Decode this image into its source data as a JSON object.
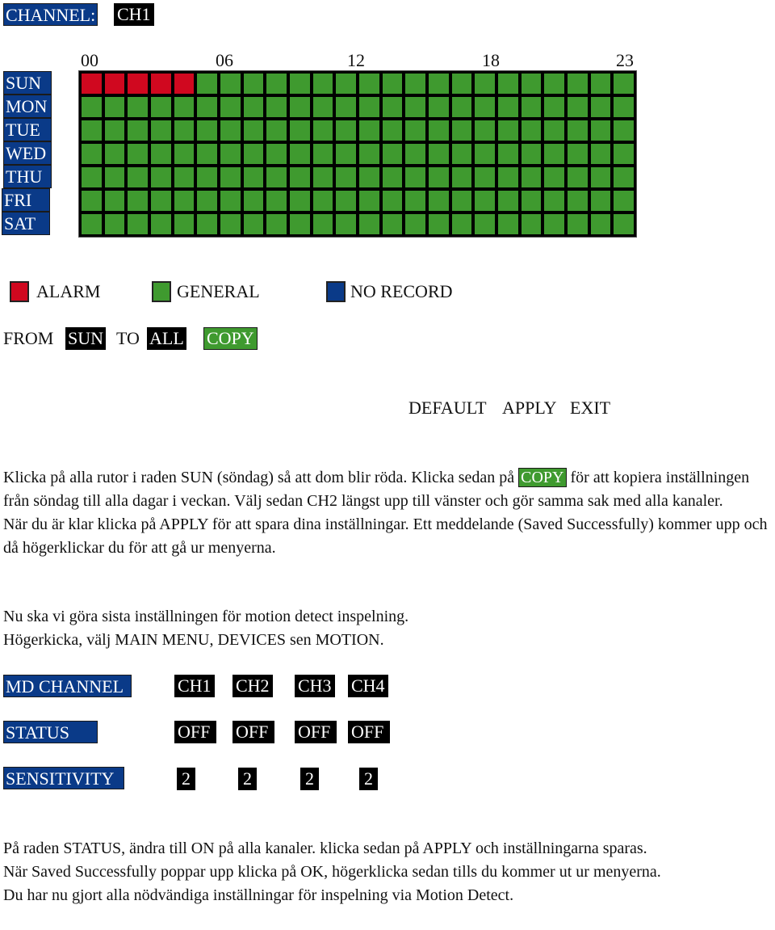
{
  "channel": {
    "label": "CHANNEL:",
    "value": "CH1"
  },
  "schedule": {
    "hour_labels": [
      "00",
      "06",
      "12",
      "18",
      "23"
    ],
    "days": [
      "SUN",
      "MON",
      "TUE",
      "WED",
      "THU",
      "FRI",
      "SAT"
    ],
    "hours_per_day": 24,
    "alarm_cells": {
      "SUN": [
        0,
        1,
        2,
        3,
        4
      ]
    },
    "default_mode": "general"
  },
  "legend": {
    "items": [
      {
        "label": "ALARM",
        "color": "#d0081f"
      },
      {
        "label": "GENERAL",
        "color": "#3f9a2f"
      },
      {
        "label": "NO RECORD",
        "color": "#0a3a88"
      }
    ]
  },
  "copy_row": {
    "from_label": "FROM",
    "from_value": "SUN",
    "to_label": "TO",
    "to_value": "ALL",
    "copy_button": "COPY"
  },
  "actions": {
    "default": "DEFAULT",
    "apply": "APPLY",
    "exit": "EXIT"
  },
  "instructions1": {
    "line1_before": "Klicka på alla rutor i raden SUN (söndag) så att dom blir röda. Klicka sedan på ",
    "line1_copy": "COPY",
    "line1_after": " för att kopiera inställningen från söndag till alla dagar i veckan. Välj sedan CH2 längst upp till vänster och gör samma sak med alla kanaler.",
    "line2": "När du är klar klicka på APPLY för att spara dina inställningar. Ett meddelande (Saved Successfully) kommer upp och då högerklickar du för att gå ur menyerna."
  },
  "instructions2": {
    "line1": "Nu ska vi göra sista inställningen för motion detect inspelning.",
    "line2": "Högerkicka, välj MAIN MENU, DEVICES sen MOTION."
  },
  "motion": {
    "md_channel_label": "MD CHANNEL",
    "status_label": "STATUS",
    "sensitivity_label": "SENSITIVITY",
    "channels": [
      "CH1",
      "CH2",
      "CH3",
      "CH4"
    ],
    "status": [
      "OFF",
      "OFF",
      "OFF",
      "OFF"
    ],
    "sensitivity": [
      "2",
      "2",
      "2",
      "2"
    ]
  },
  "instructions3": {
    "line1": "På raden STATUS, ändra till ON på alla kanaler. klicka sedan på APPLY och inställningarna sparas.",
    "line2": "När Saved Successfully poppar upp klicka på OK, högerklicka sedan tills du kommer ut ur menyerna.",
    "line3": "Du har nu gjort alla nödvändiga inställningar för inspelning via Motion Detect."
  }
}
